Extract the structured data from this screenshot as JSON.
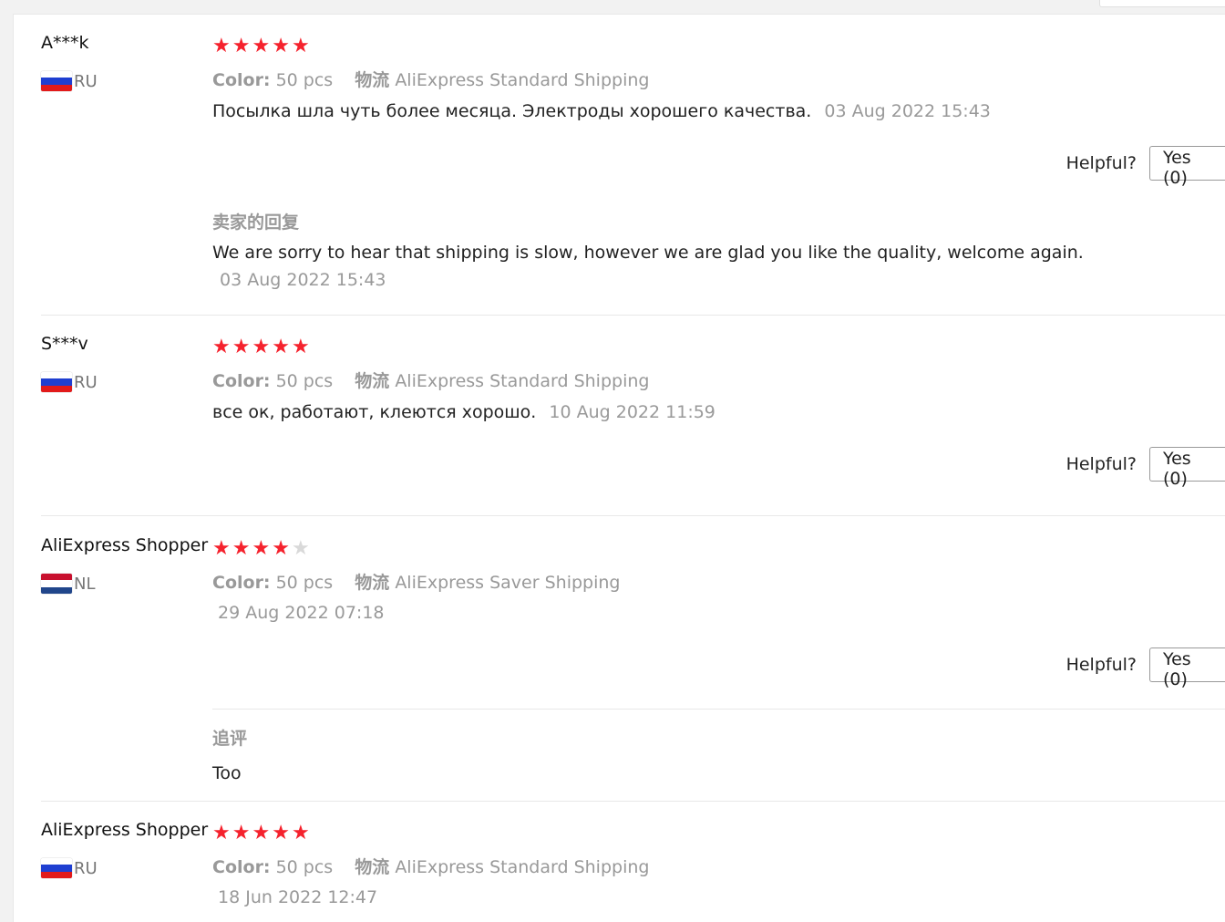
{
  "labels": {
    "color": "Color:",
    "shipping": "物流",
    "helpful": "Helpful?",
    "yes": "Yes (0)"
  },
  "colors": {
    "star_on": "#f5222d",
    "star_off": "#d9d9d9"
  },
  "reviews": [
    {
      "user": "A***k",
      "country": "RU",
      "rating": 5,
      "color": "50 pcs",
      "shipping": "AliExpress Standard Shipping",
      "text": "Посылка шла чуть более месяца. Электроды хорошего качества.",
      "date": "03 Aug 2022 15:43",
      "reply_title": "卖家的回复",
      "reply_text": "We are sorry to hear that shipping is slow, however we are glad you like the quality, welcome again.",
      "reply_date": "03 Aug 2022 15:43"
    },
    {
      "user": "S***v",
      "country": "RU",
      "rating": 5,
      "color": "50 pcs",
      "shipping": "AliExpress Standard Shipping",
      "text": "все ок, работают, клеются хорошо.",
      "date": "10 Aug 2022 11:59"
    },
    {
      "user": "AliExpress Shopper",
      "country": "NL",
      "rating": 4,
      "color": "50 pcs",
      "shipping": "AliExpress Saver Shipping",
      "text": "",
      "date": "29 Aug 2022 07:18",
      "followup_title": "追评",
      "followup_text": "Too"
    },
    {
      "user": "AliExpress Shopper",
      "country": "RU",
      "rating": 5,
      "color": "50 pcs",
      "shipping": "AliExpress Standard Shipping",
      "text": "",
      "date": "18 Jun 2022 12:47"
    }
  ]
}
